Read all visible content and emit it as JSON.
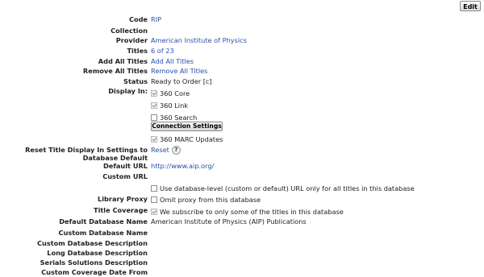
{
  "toolbar": {
    "edit_label": "Edit"
  },
  "labels": {
    "code": "Code",
    "collection": "Collection",
    "provider": "Provider",
    "titles": "Titles",
    "add_all_titles": "Add All Titles",
    "remove_all_titles": "Remove All Titles",
    "status": "Status",
    "display_in": "Display In:",
    "reset_title_display": "Reset Title Display In Settings to Database Default",
    "default_url": "Default URL",
    "custom_url": "Custom URL",
    "library_proxy": "Library Proxy",
    "title_coverage": "Title Coverage",
    "default_database_name": "Default Database Name",
    "custom_database_name": "Custom Database Name",
    "custom_database_description": "Custom Database Description",
    "long_database_description": "Long Database Description",
    "serials_solutions_description": "Serials Solutions Description",
    "custom_coverage_date_from": "Custom Coverage Date From"
  },
  "values": {
    "code": "RIP",
    "provider": "American Institute of Physics",
    "titles": "6 of 23",
    "add_all_titles": "Add All Titles",
    "remove_all_titles": "Remove All Titles",
    "status": "Ready to Order [c]",
    "reset": "Reset",
    "help_glyph": "?",
    "default_url": "http://www.aip.org/",
    "default_database_name": "American Institute of Physics (AIP) Publications"
  },
  "display_in": {
    "core": "360 Core",
    "link": "360 Link",
    "search": "360 Search",
    "connection_settings": "Connection Settings",
    "marc": "360 MARC Updates"
  },
  "options": {
    "use_db_level_url": "Use database-level (custom or default) URL only for all titles in this database",
    "omit_proxy": "Omit proxy from this database",
    "subscribe_some": "We subscribe to only some of the titles in this database"
  },
  "colors": {
    "link": "#2a4fa8",
    "text": "#222222"
  }
}
